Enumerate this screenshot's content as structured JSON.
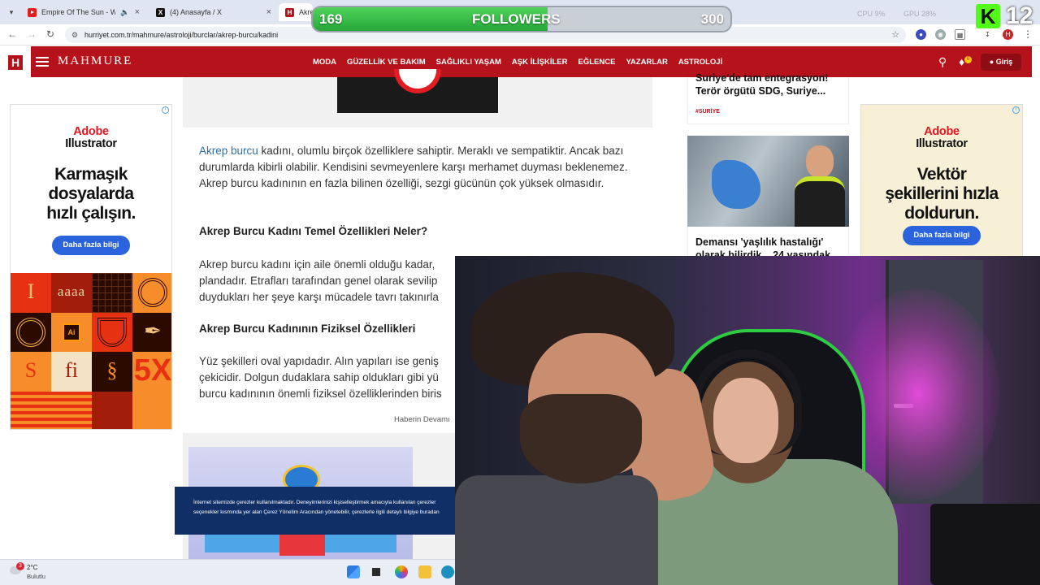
{
  "browser": {
    "tabs": [
      {
        "title": "Empire Of The Sun - We Are The People",
        "icon": "youtube-icon",
        "audio": true
      },
      {
        "title": "(4) Anasayfa / X",
        "icon": "x-logo-icon"
      },
      {
        "title": "Akrep Burcu Kadını",
        "icon": "hurriyet-icon",
        "active": true
      }
    ],
    "url": "hurriyet.com.tr/mahmure/astroloji/burclar/akrep-burcu/kadini",
    "profile_initial": "H"
  },
  "overlay": {
    "followers_label": "FOLLOWERS",
    "current": "169",
    "goal": "300",
    "progress_fraction": 0.563,
    "kick_logo": "K",
    "kick_viewers": "12",
    "perf_cpu": "CPU 9%",
    "perf_gpu": "GPU 28%",
    "colors": {
      "bar_fill": "#26a83a",
      "kick": "#53fc18"
    }
  },
  "site": {
    "brand": "MAHMURE",
    "logo_letter": "H",
    "nav": [
      "MODA",
      "GÜZELLİK VE BAKIM",
      "SAĞLIKLI YAŞAM",
      "AŞK İLİŞKİLER",
      "EĞLENCE",
      "YAZARLAR",
      "ASTROLOJİ"
    ],
    "notification_count": "0",
    "login_label": "Giriş",
    "accent": "#b5121b"
  },
  "article": {
    "p1_link": "Akrep burcu",
    "p1_rest": " kadını, olumlu birçok özelliklere sahiptir. Meraklı ve sempatiktir. Ancak bazı durumlarda kibirli olabilir. Kendisini sevmeyenlere karşı merhamet duyması beklenemez. Akrep burcu kadınının en fazla bilinen özelliği, sezgi gücünün çok yüksek olmasıdır.",
    "h1": "Akrep Burcu Kadını Temel Özellikleri Neler?",
    "p2_line1": "Akrep burcu kadını için aile önemli olduğu kadar,",
    "p2_line2": "plandadır. Etrafları tarafından genel olarak sevilip",
    "p2_line3": "duydukları her şeye karşı mücadele tavrı takınırla",
    "h2": "Akrep Burcu Kadınının Fiziksel Özellikleri",
    "p3_line1": "Yüz şekilleri oval yapıdadır. Alın yapıları ise geniş",
    "p3_line2": "çekicidir. Dolgun dudaklara sahip oldukları gibi yü",
    "p3_line3": "burcu kadınının önemli fiziksel özelliklerinden biris",
    "source": "Haberin Devamı"
  },
  "cookie": {
    "line1": "İnternet sitemizde çerezler kullanılmaktadır. Deneyimlerinizi kişiselleştirmek amacıyla kullanılan çerezler",
    "line2": "seçenekler kısmında yer alan Çerez Yönetim Aracından yönetebilir, çerezlerle ilgili detaylı bilgiye buradan"
  },
  "ad_left": {
    "brand_top": "Adobe",
    "brand_bottom": "Illustrator",
    "headline_1": "Karmaşık",
    "headline_2": "dosyalarda",
    "headline_3": "hızlı çalışın.",
    "cta": "Daha fazla bilgi",
    "tile_ai": "Ai",
    "tile_5x": "5X",
    "tile_fi": "fi",
    "tile_aaaa": "aaaa"
  },
  "ad_right": {
    "brand_top": "Adobe",
    "brand_bottom": "Illustrator",
    "headline_1": "Vektör",
    "headline_2": "şekillerini hızla",
    "headline_3": "doldurun.",
    "cta": "Daha fazla bilgi"
  },
  "sidebar": {
    "card1_title": "Suriye'de tam entegrasyon! Terör örgütü SDG, Suriye...",
    "card1_tag": "#SURİYE",
    "card2_title": "Demansı 'yaşlılık hastalığı' olarak bilirdik... 24 yaşındak"
  },
  "taskbar": {
    "temp": "2°C",
    "condition": "Bulutlu",
    "badge": "3"
  }
}
